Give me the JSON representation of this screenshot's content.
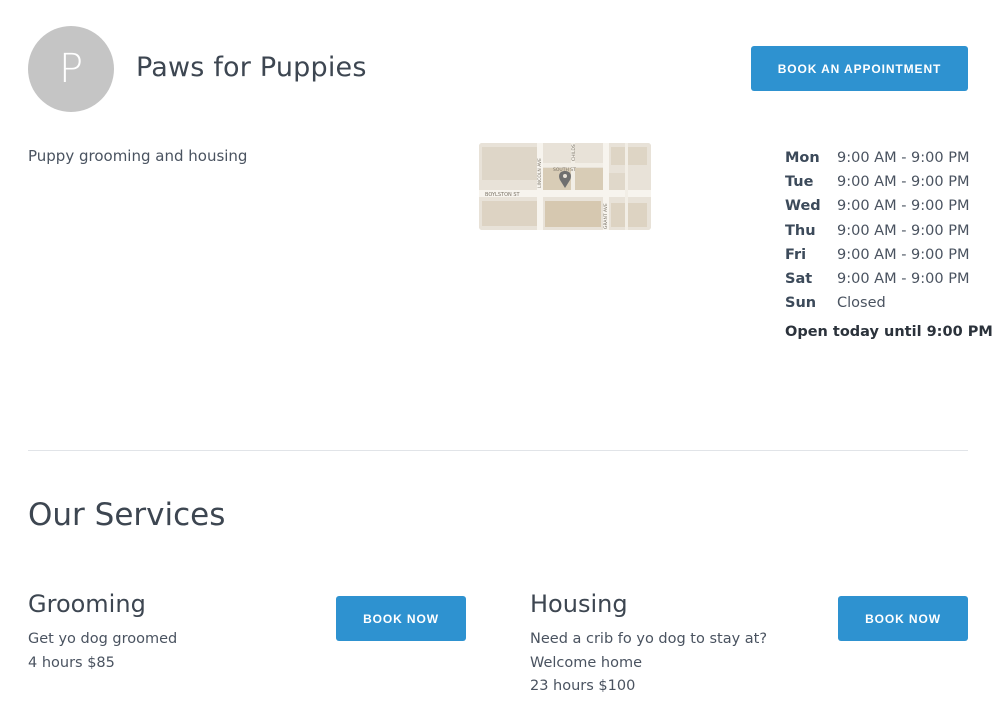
{
  "business": {
    "avatar_letter": "P",
    "name": "Paws for Puppies",
    "description": "Puppy grooming and housing",
    "book_appointment_label": "BOOK AN APPOINTMENT"
  },
  "map": {
    "street_labels": [
      "BOYLSTON ST",
      "LINCOLN AVE",
      "CHILDS",
      "SOUTH ST",
      "GRANT AVE"
    ]
  },
  "hours": {
    "rows": [
      {
        "day": "Mon",
        "time": "9:00 AM - 9:00 PM"
      },
      {
        "day": "Tue",
        "time": "9:00 AM - 9:00 PM"
      },
      {
        "day": "Wed",
        "time": "9:00 AM - 9:00 PM"
      },
      {
        "day": "Thu",
        "time": "9:00 AM - 9:00 PM"
      },
      {
        "day": "Fri",
        "time": "9:00 AM - 9:00 PM"
      },
      {
        "day": "Sat",
        "time": "9:00 AM - 9:00 PM"
      },
      {
        "day": "Sun",
        "time": "Closed"
      }
    ],
    "open_today": "Open today until 9:00 PM"
  },
  "services": {
    "title": "Our Services",
    "items": [
      {
        "name": "Grooming",
        "description": "Get yo dog groomed",
        "meta": "4 hours $85",
        "button_label": "BOOK NOW"
      },
      {
        "name": "Housing",
        "description": "Need a crib fo yo dog to stay at? Welcome home",
        "meta": "23 hours $100",
        "button_label": "BOOK NOW"
      }
    ]
  },
  "colors": {
    "accent": "#2e92d0",
    "avatar_bg": "#c5c5c5",
    "divider": "#e1e4e8"
  }
}
